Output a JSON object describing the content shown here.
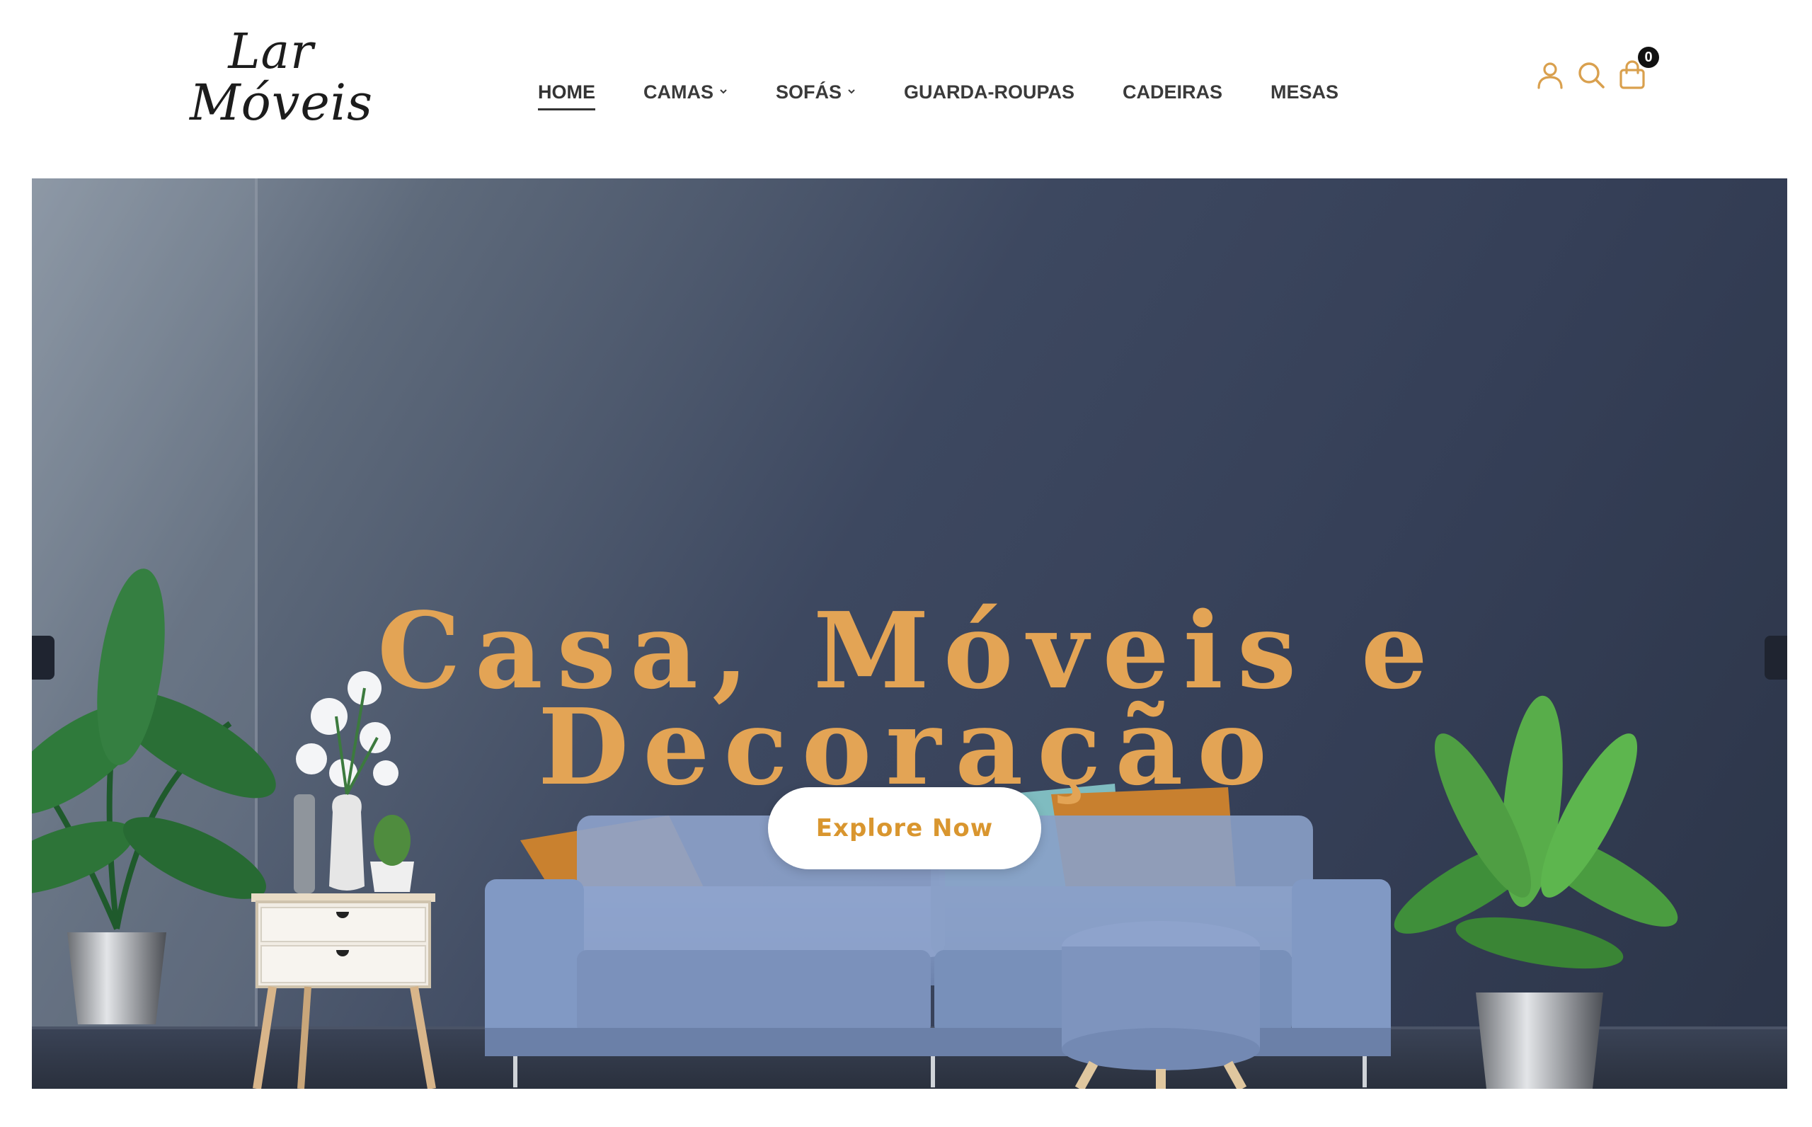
{
  "brand": {
    "logo_line1": "Lar",
    "logo_line2": "Móveis"
  },
  "nav": {
    "items": [
      {
        "label": "HOME",
        "active": true,
        "has_dropdown": false
      },
      {
        "label": "CAMAS",
        "active": false,
        "has_dropdown": true
      },
      {
        "label": "SOFÁS",
        "active": false,
        "has_dropdown": true
      },
      {
        "label": "GUARDA-ROUPAS",
        "active": false,
        "has_dropdown": false
      },
      {
        "label": "CADEIRAS",
        "active": false,
        "has_dropdown": false
      },
      {
        "label": "MESAS",
        "active": false,
        "has_dropdown": false
      }
    ]
  },
  "header_icons": {
    "account": "user-icon",
    "search": "search-icon",
    "cart": "shopping-bag-icon",
    "cart_count": "0",
    "icon_color": "#d9a04e"
  },
  "hero": {
    "title_line1": "Casa, Móveis e",
    "title_line2": "Decoração",
    "cta_label": "Explore Now",
    "title_color": "#e3a455",
    "cta_text_color": "#d9962f"
  }
}
